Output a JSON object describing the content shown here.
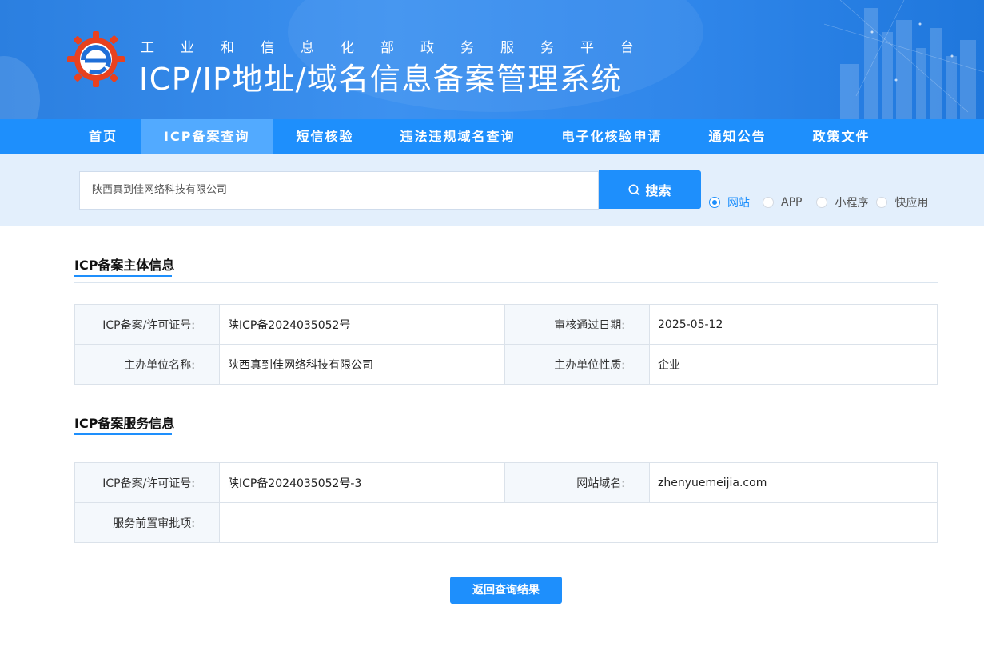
{
  "header": {
    "subtitle": "工业和信息化部政务服务平台",
    "title": "ICP/IP地址/域名信息备案管理系统"
  },
  "nav": {
    "items": [
      {
        "label": "首页"
      },
      {
        "label": "ICP备案查询"
      },
      {
        "label": "短信核验"
      },
      {
        "label": "违法违规域名查询"
      },
      {
        "label": "电子化核验申请"
      },
      {
        "label": "通知公告"
      },
      {
        "label": "政策文件"
      }
    ],
    "active_index": 1
  },
  "search": {
    "value": "陕西真到佳网络科技有限公司",
    "button_label": "搜索",
    "types": [
      {
        "label": "网站",
        "checked": true
      },
      {
        "label": "APP",
        "checked": false
      },
      {
        "label": "小程序",
        "checked": false
      },
      {
        "label": "快应用",
        "checked": false
      }
    ]
  },
  "subject_section": {
    "title": "ICP备案主体信息",
    "rows": [
      {
        "k1": "ICP备案/许可证号:",
        "v1": "陕ICP备2024035052号",
        "k2": "审核通过日期:",
        "v2": "2025-05-12"
      },
      {
        "k1": "主办单位名称:",
        "v1": "陕西真到佳网络科技有限公司",
        "k2": "主办单位性质:",
        "v2": "企业"
      }
    ]
  },
  "service_section": {
    "title": "ICP备案服务信息",
    "row1": {
      "k1": "ICP备案/许可证号:",
      "v1": "陕ICP备2024035052号-3",
      "k2": "网站域名:",
      "v2": "zhenyuemeijia.com"
    },
    "row2": {
      "k1": "服务前置审批项:",
      "v1": ""
    }
  },
  "back_button_label": "返回查询结果",
  "colors": {
    "primary": "#1e8ffc",
    "nav_active": "#52aaff",
    "search_bg": "#e3effc",
    "key_cell_bg": "#f4f8fc",
    "logo_red": "#e8411f"
  }
}
